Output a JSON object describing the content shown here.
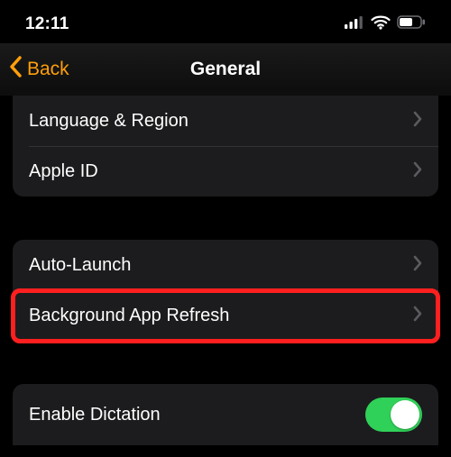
{
  "status": {
    "time": "12:11"
  },
  "nav": {
    "back": "Back",
    "title": "General"
  },
  "group1": {
    "language_region": "Language & Region",
    "apple_id": "Apple ID"
  },
  "group2": {
    "auto_launch": "Auto-Launch",
    "bg_refresh": "Background App Refresh"
  },
  "group3": {
    "enable_dictation": "Enable Dictation",
    "enable_dictation_on": true
  },
  "colors": {
    "accent": "#ff9f0a",
    "toggle_on": "#30d158",
    "highlight": "#ff1f1f",
    "cell_bg": "#1c1c1e"
  }
}
